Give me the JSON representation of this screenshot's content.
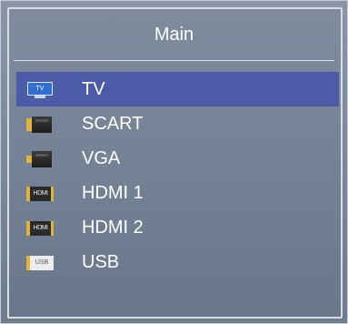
{
  "window": {
    "title": "Main"
  },
  "menu": {
    "items": [
      {
        "label": "TV",
        "icon": "tv-icon",
        "icon_text": "TV",
        "selected": true
      },
      {
        "label": "SCART",
        "icon": "scart-icon",
        "selected": false
      },
      {
        "label": "VGA",
        "icon": "vga-icon",
        "selected": false
      },
      {
        "label": "HDMI 1",
        "icon": "hdmi-icon",
        "icon_text": "HDMI",
        "selected": false
      },
      {
        "label": "HDMI 2",
        "icon": "hdmi-icon",
        "icon_text": "HDMI",
        "selected": false
      },
      {
        "label": "USB",
        "icon": "usb-icon",
        "icon_text": "USB",
        "selected": false
      }
    ]
  },
  "colors": {
    "selection": "#4b5ba8",
    "panel": "#7c889b",
    "text": "#ffffff",
    "connector_gold": "#e2b33a"
  }
}
